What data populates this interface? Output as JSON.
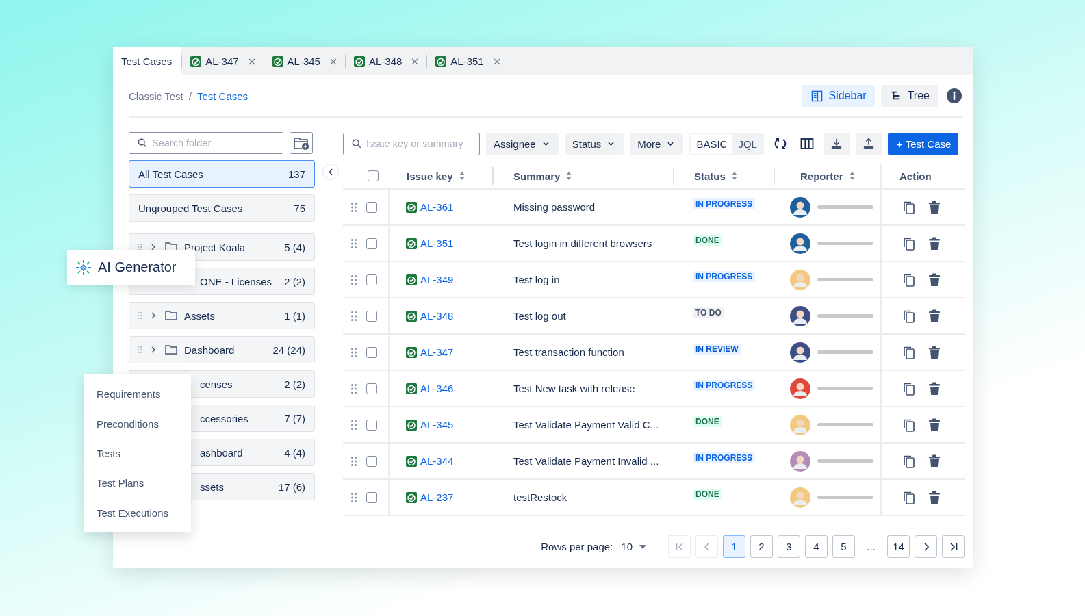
{
  "tabs": [
    {
      "label": "Test Cases",
      "selected": true,
      "kind": "plain"
    },
    {
      "label": "AL-347",
      "selected": false,
      "kind": "test"
    },
    {
      "label": "AL-345",
      "selected": false,
      "kind": "test"
    },
    {
      "label": "AL-348",
      "selected": false,
      "kind": "test"
    },
    {
      "label": "AL-351",
      "selected": false,
      "kind": "test"
    }
  ],
  "breadcrumb": {
    "separator": "/",
    "items": [
      {
        "label": "Classic Test",
        "current": false
      },
      {
        "label": "Test Cases",
        "current": true
      }
    ]
  },
  "view_buttons": [
    {
      "label": "Sidebar",
      "selected": true,
      "kind": "sidebar"
    },
    {
      "label": "Tree",
      "selected": false,
      "kind": "tree"
    }
  ],
  "folders": {
    "search_placeholder": "Search folder",
    "items": [
      {
        "label": "All Test Cases",
        "count": "137",
        "selected": true,
        "kind": "plain"
      },
      {
        "label": "Ungrouped Test Cases",
        "count": "75",
        "selected": false,
        "kind": "plain"
      },
      {
        "label": "Project Koala",
        "count": "5 (4)",
        "selected": false,
        "kind": "folder"
      },
      {
        "label": "ONE - Licenses",
        "count": "2 (2)",
        "selected": false,
        "kind": "covered"
      },
      {
        "label": "Assets",
        "count": "1 (1)",
        "selected": false,
        "kind": "folder"
      },
      {
        "label": "Dashboard",
        "count": "24 (24)",
        "selected": false,
        "kind": "folder"
      },
      {
        "label": "censes",
        "count": "2 (2)",
        "selected": false,
        "kind": "covered"
      },
      {
        "label": "ccessories",
        "count": "7 (7)",
        "selected": false,
        "kind": "covered"
      },
      {
        "label": "ashboard",
        "count": "4 (4)",
        "selected": false,
        "kind": "covered"
      },
      {
        "label": "ssets",
        "count": "17 (6)",
        "selected": false,
        "kind": "covered"
      }
    ]
  },
  "toolbar": {
    "search_placeholder": "Issue key or summary",
    "filters": [
      "Assignee",
      "Status",
      "More"
    ],
    "modes": [
      {
        "label": "BASIC",
        "selected": true
      },
      {
        "label": "JQL",
        "selected": false
      }
    ],
    "add_button": "+ Test Case"
  },
  "table": {
    "columns": [
      {
        "label": "Issue key",
        "kind": "sortable"
      },
      {
        "label": "Summary",
        "kind": "sortable"
      },
      {
        "label": "Status",
        "kind": "sortable"
      },
      {
        "label": "Reporter",
        "kind": "sortable"
      },
      {
        "label": "Action",
        "kind": "plain"
      }
    ],
    "all_checked": false,
    "rows": [
      {
        "key": "AL-361",
        "summary": "Missing password",
        "status": "IN PROGRESS",
        "kind": "progress",
        "checked": false
      },
      {
        "key": "AL-351",
        "summary": "Test login in different browsers",
        "status": "DONE",
        "kind": "done",
        "checked": false
      },
      {
        "key": "AL-349",
        "summary": "Test log in",
        "status": "IN PROGRESS",
        "kind": "progress",
        "checked": false
      },
      {
        "key": "AL-348",
        "summary": "Test log out",
        "status": "TO DO",
        "kind": "todo",
        "checked": false
      },
      {
        "key": "AL-347",
        "summary": "Test transaction function",
        "status": "IN REVIEW",
        "kind": "review",
        "checked": false
      },
      {
        "key": "AL-346",
        "summary": "Test New task with release",
        "status": "IN PROGRESS",
        "kind": "progress",
        "checked": false
      },
      {
        "key": "AL-345",
        "summary": "Test Validate Payment Valid C...",
        "status": "DONE",
        "kind": "done",
        "checked": false
      },
      {
        "key": "AL-344",
        "summary": "Test Validate Payment Invalid ...",
        "status": "IN PROGRESS",
        "kind": "progress",
        "checked": false
      },
      {
        "key": "AL-237",
        "summary": "testRestock",
        "status": "DONE",
        "kind": "done",
        "checked": false
      }
    ]
  },
  "pagination": {
    "rows_label": "Rows per page:",
    "rows_value": "10",
    "pages": [
      {
        "label": "1",
        "selected": true,
        "kind": "page"
      },
      {
        "label": "2",
        "selected": false,
        "kind": "page"
      },
      {
        "label": "3",
        "selected": false,
        "kind": "page"
      },
      {
        "label": "4",
        "selected": false,
        "kind": "page"
      },
      {
        "label": "5",
        "selected": false,
        "kind": "page"
      },
      {
        "label": "...",
        "kind": "gap"
      },
      {
        "label": "14",
        "selected": false,
        "kind": "page"
      }
    ]
  },
  "ai_popup": {
    "label": "AI Generator"
  },
  "menu": {
    "items": [
      "Requirements",
      "Preconditions",
      "Tests",
      "Test Plans",
      "Test Executions"
    ]
  }
}
